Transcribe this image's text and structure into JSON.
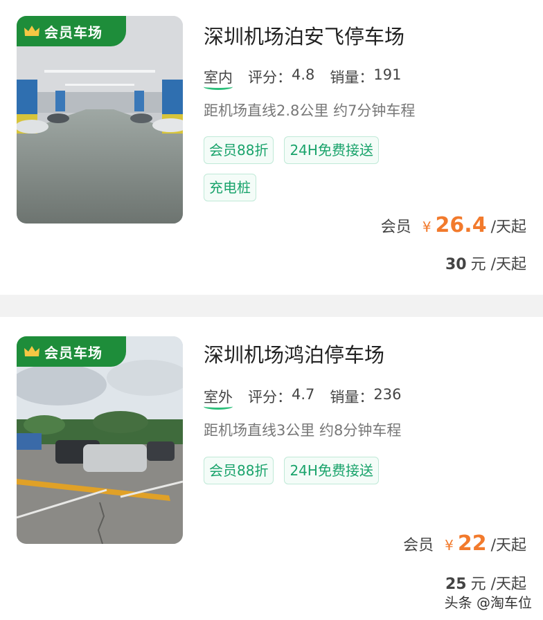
{
  "listings": [
    {
      "badge": "会员车场",
      "name": "深圳机场泊安飞停车场",
      "type": "室内",
      "rating_label": "评分：",
      "rating": "4.8",
      "sales_label": "销量：",
      "sales": "191",
      "distance": "距机场直线2.8公里 约7分钟车程",
      "tags": [
        "会员88折",
        "24H免费接送",
        "充电桩"
      ],
      "member_label": "会员",
      "currency": "¥",
      "member_price": "26.4",
      "per_day": "/天起",
      "orig_price": "30",
      "orig_unit": "元",
      "orig_per_day": "/天起"
    },
    {
      "badge": "会员车场",
      "name": "深圳机场鸿泊停车场",
      "type": "室外",
      "rating_label": "评分：",
      "rating": "4.7",
      "sales_label": "销量：",
      "sales": "236",
      "distance": "距机场直线3公里 约8分钟车程",
      "tags": [
        "会员88折",
        "24H免费接送"
      ],
      "member_label": "会员",
      "currency": "¥",
      "member_price": "22",
      "per_day": "/天起",
      "orig_price": "25",
      "orig_unit": "元",
      "orig_per_day": "/天起"
    }
  ],
  "watermark": "头条 @淘车位",
  "colors": {
    "accent": "#f27a2c",
    "tag_green": "#19a36b",
    "badge_green": "#1e8d3a"
  }
}
